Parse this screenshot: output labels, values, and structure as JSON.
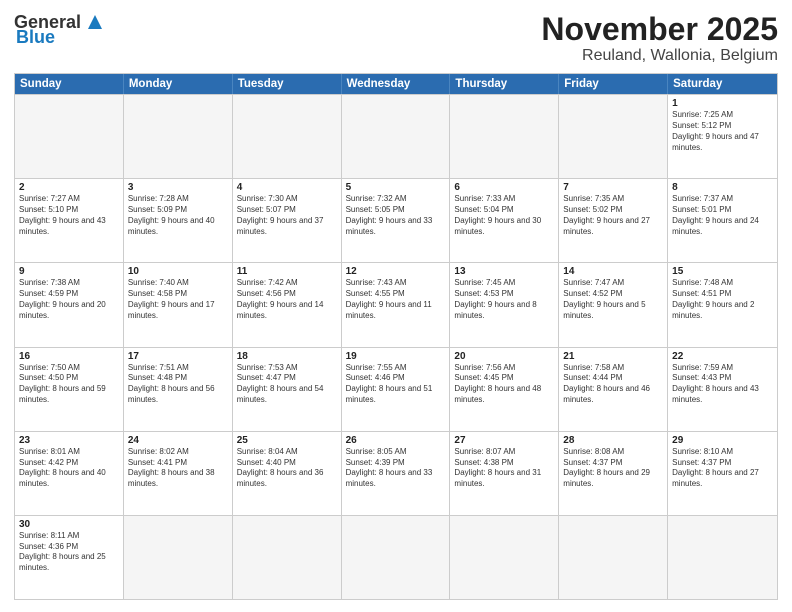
{
  "header": {
    "logo_general": "General",
    "logo_blue": "Blue",
    "month": "November 2025",
    "location": "Reuland, Wallonia, Belgium"
  },
  "weekdays": [
    "Sunday",
    "Monday",
    "Tuesday",
    "Wednesday",
    "Thursday",
    "Friday",
    "Saturday"
  ],
  "weeks": [
    [
      {
        "day": "",
        "info": ""
      },
      {
        "day": "",
        "info": ""
      },
      {
        "day": "",
        "info": ""
      },
      {
        "day": "",
        "info": ""
      },
      {
        "day": "",
        "info": ""
      },
      {
        "day": "",
        "info": ""
      },
      {
        "day": "1",
        "info": "Sunrise: 7:25 AM\nSunset: 5:12 PM\nDaylight: 9 hours and 47 minutes."
      }
    ],
    [
      {
        "day": "2",
        "info": "Sunrise: 7:27 AM\nSunset: 5:10 PM\nDaylight: 9 hours and 43 minutes."
      },
      {
        "day": "3",
        "info": "Sunrise: 7:28 AM\nSunset: 5:09 PM\nDaylight: 9 hours and 40 minutes."
      },
      {
        "day": "4",
        "info": "Sunrise: 7:30 AM\nSunset: 5:07 PM\nDaylight: 9 hours and 37 minutes."
      },
      {
        "day": "5",
        "info": "Sunrise: 7:32 AM\nSunset: 5:05 PM\nDaylight: 9 hours and 33 minutes."
      },
      {
        "day": "6",
        "info": "Sunrise: 7:33 AM\nSunset: 5:04 PM\nDaylight: 9 hours and 30 minutes."
      },
      {
        "day": "7",
        "info": "Sunrise: 7:35 AM\nSunset: 5:02 PM\nDaylight: 9 hours and 27 minutes."
      },
      {
        "day": "8",
        "info": "Sunrise: 7:37 AM\nSunset: 5:01 PM\nDaylight: 9 hours and 24 minutes."
      }
    ],
    [
      {
        "day": "9",
        "info": "Sunrise: 7:38 AM\nSunset: 4:59 PM\nDaylight: 9 hours and 20 minutes."
      },
      {
        "day": "10",
        "info": "Sunrise: 7:40 AM\nSunset: 4:58 PM\nDaylight: 9 hours and 17 minutes."
      },
      {
        "day": "11",
        "info": "Sunrise: 7:42 AM\nSunset: 4:56 PM\nDaylight: 9 hours and 14 minutes."
      },
      {
        "day": "12",
        "info": "Sunrise: 7:43 AM\nSunset: 4:55 PM\nDaylight: 9 hours and 11 minutes."
      },
      {
        "day": "13",
        "info": "Sunrise: 7:45 AM\nSunset: 4:53 PM\nDaylight: 9 hours and 8 minutes."
      },
      {
        "day": "14",
        "info": "Sunrise: 7:47 AM\nSunset: 4:52 PM\nDaylight: 9 hours and 5 minutes."
      },
      {
        "day": "15",
        "info": "Sunrise: 7:48 AM\nSunset: 4:51 PM\nDaylight: 9 hours and 2 minutes."
      }
    ],
    [
      {
        "day": "16",
        "info": "Sunrise: 7:50 AM\nSunset: 4:50 PM\nDaylight: 8 hours and 59 minutes."
      },
      {
        "day": "17",
        "info": "Sunrise: 7:51 AM\nSunset: 4:48 PM\nDaylight: 8 hours and 56 minutes."
      },
      {
        "day": "18",
        "info": "Sunrise: 7:53 AM\nSunset: 4:47 PM\nDaylight: 8 hours and 54 minutes."
      },
      {
        "day": "19",
        "info": "Sunrise: 7:55 AM\nSunset: 4:46 PM\nDaylight: 8 hours and 51 minutes."
      },
      {
        "day": "20",
        "info": "Sunrise: 7:56 AM\nSunset: 4:45 PM\nDaylight: 8 hours and 48 minutes."
      },
      {
        "day": "21",
        "info": "Sunrise: 7:58 AM\nSunset: 4:44 PM\nDaylight: 8 hours and 46 minutes."
      },
      {
        "day": "22",
        "info": "Sunrise: 7:59 AM\nSunset: 4:43 PM\nDaylight: 8 hours and 43 minutes."
      }
    ],
    [
      {
        "day": "23",
        "info": "Sunrise: 8:01 AM\nSunset: 4:42 PM\nDaylight: 8 hours and 40 minutes."
      },
      {
        "day": "24",
        "info": "Sunrise: 8:02 AM\nSunset: 4:41 PM\nDaylight: 8 hours and 38 minutes."
      },
      {
        "day": "25",
        "info": "Sunrise: 8:04 AM\nSunset: 4:40 PM\nDaylight: 8 hours and 36 minutes."
      },
      {
        "day": "26",
        "info": "Sunrise: 8:05 AM\nSunset: 4:39 PM\nDaylight: 8 hours and 33 minutes."
      },
      {
        "day": "27",
        "info": "Sunrise: 8:07 AM\nSunset: 4:38 PM\nDaylight: 8 hours and 31 minutes."
      },
      {
        "day": "28",
        "info": "Sunrise: 8:08 AM\nSunset: 4:37 PM\nDaylight: 8 hours and 29 minutes."
      },
      {
        "day": "29",
        "info": "Sunrise: 8:10 AM\nSunset: 4:37 PM\nDaylight: 8 hours and 27 minutes."
      }
    ],
    [
      {
        "day": "30",
        "info": "Sunrise: 8:11 AM\nSunset: 4:36 PM\nDaylight: 8 hours and 25 minutes."
      },
      {
        "day": "",
        "info": ""
      },
      {
        "day": "",
        "info": ""
      },
      {
        "day": "",
        "info": ""
      },
      {
        "day": "",
        "info": ""
      },
      {
        "day": "",
        "info": ""
      },
      {
        "day": "",
        "info": ""
      }
    ]
  ]
}
